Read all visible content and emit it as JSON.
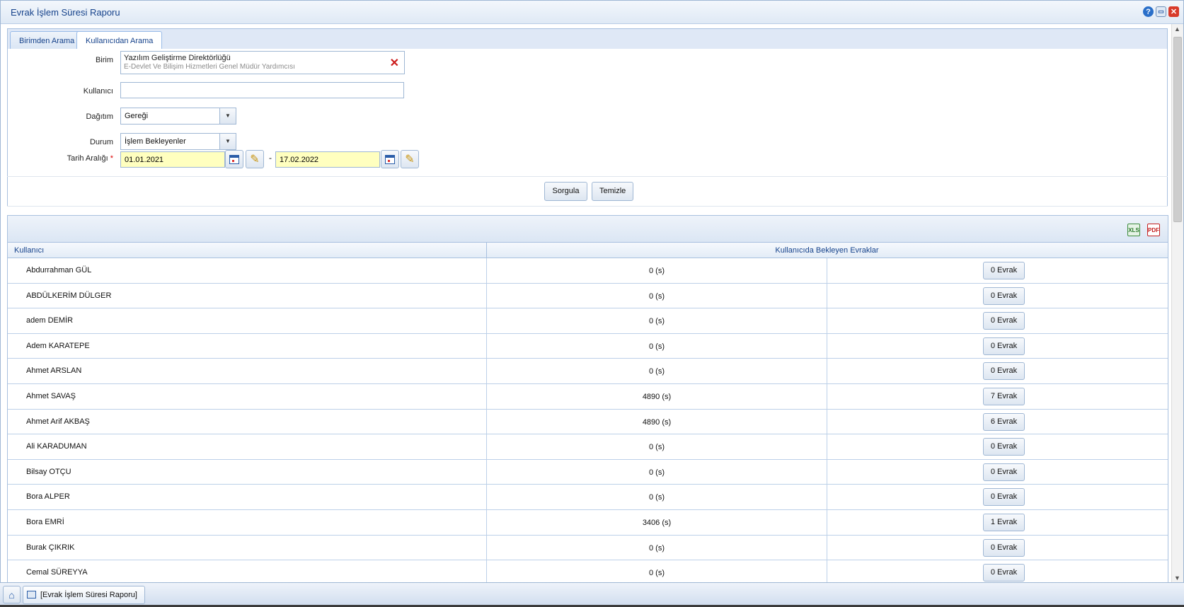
{
  "window": {
    "title": "Evrak İşlem Süresi Raporu"
  },
  "tabs": [
    {
      "label": "Birimden Arama"
    },
    {
      "label": "Kullanıcıdan Arama"
    }
  ],
  "form": {
    "birim_label": "Birim",
    "birim_main": "Yazılım Geliştirme Direktörlüğü",
    "birim_sub": "E-Devlet Ve Bilişim Hizmetleri Genel Müdür Yardımcısı",
    "kullanici_label": "Kullanıcı",
    "kullanici_value": "",
    "dagitim_label": "Dağıtım",
    "dagitim_value": "Gereği",
    "durum_label": "Durum",
    "durum_value": "İşlem Bekleyenler",
    "tarih_label": "Tarih Aralığı",
    "required_mark": "*",
    "tarih_start": "01.01.2021",
    "tarih_dash": "-",
    "tarih_end": "17.02.2022"
  },
  "actions": {
    "query": "Sorgula",
    "clear": "Temizle"
  },
  "grid": {
    "col_user": "Kullanıcı",
    "col_waiting": "Kullanıcıda Bekleyen Evraklar",
    "export_excel": "XLS",
    "export_pdf": "PDF",
    "rows": [
      {
        "user": "Abdurrahman GÜL",
        "duration": "0 (s)",
        "count": "0 Evrak"
      },
      {
        "user": "ABDÜLKERİM DÜLGER",
        "duration": "0 (s)",
        "count": "0 Evrak"
      },
      {
        "user": "adem DEMİR",
        "duration": "0 (s)",
        "count": "0 Evrak"
      },
      {
        "user": "Adem KARATEPE",
        "duration": "0 (s)",
        "count": "0 Evrak"
      },
      {
        "user": "Ahmet ARSLAN",
        "duration": "0 (s)",
        "count": "0 Evrak"
      },
      {
        "user": "Ahmet SAVAŞ",
        "duration": "4890 (s)",
        "count": "7 Evrak"
      },
      {
        "user": "Ahmet Arif AKBAŞ",
        "duration": "4890 (s)",
        "count": "6 Evrak"
      },
      {
        "user": "Ali KARADUMAN",
        "duration": "0 (s)",
        "count": "0 Evrak"
      },
      {
        "user": "Bilsay OTÇU",
        "duration": "0 (s)",
        "count": "0 Evrak"
      },
      {
        "user": "Bora ALPER",
        "duration": "0 (s)",
        "count": "0 Evrak"
      },
      {
        "user": "Bora EMRİ",
        "duration": "3406 (s)",
        "count": "1 Evrak"
      },
      {
        "user": "Burak ÇIKRIK",
        "duration": "0 (s)",
        "count": "0 Evrak"
      },
      {
        "user": "Cemal SÜREYYA",
        "duration": "0 (s)",
        "count": "0 Evrak"
      }
    ]
  },
  "taskbar": {
    "item": "[Evrak İşlem Süresi Raporu]"
  }
}
